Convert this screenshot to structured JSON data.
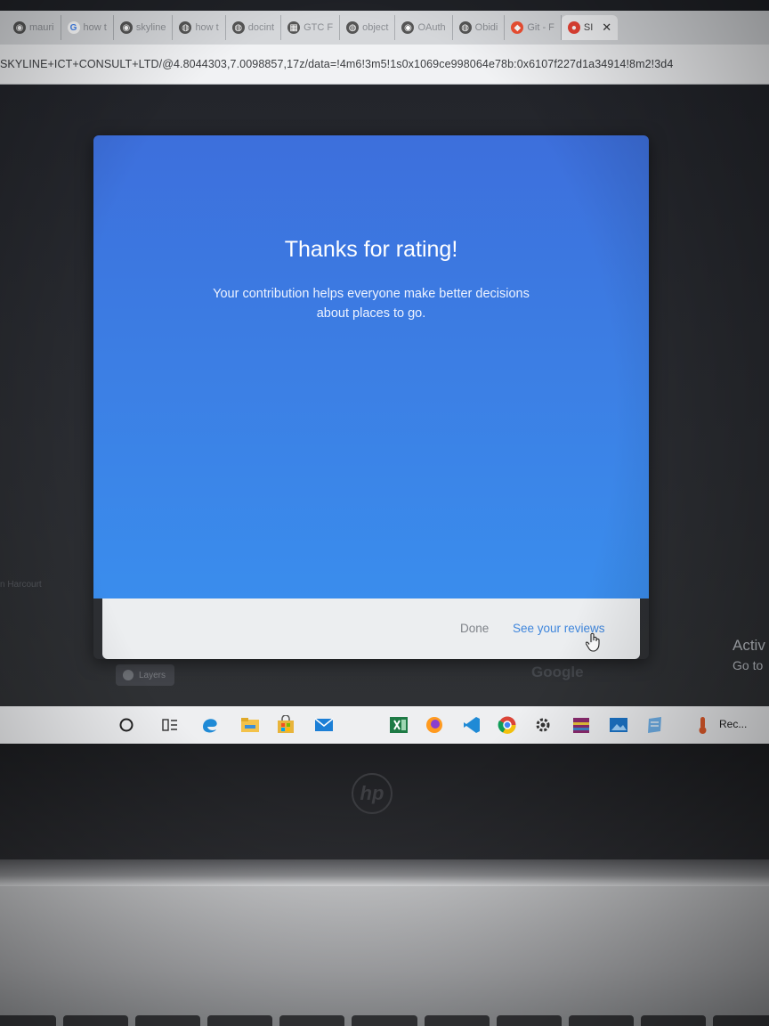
{
  "browser": {
    "tabs": [
      {
        "label": "mauri",
        "icon": "github-icon",
        "color": "#555555"
      },
      {
        "label": "how t",
        "icon": "google-icon",
        "color": "#4285f4"
      },
      {
        "label": "skyline",
        "icon": "github-icon",
        "color": "#555555"
      },
      {
        "label": "how t",
        "icon": "globe-icon",
        "color": "#555555"
      },
      {
        "label": "docint",
        "icon": "globe-icon",
        "color": "#555555"
      },
      {
        "label": "GTC F",
        "icon": "gtc-icon",
        "color": "#555555"
      },
      {
        "label": "object",
        "icon": "globe-icon",
        "color": "#555555"
      },
      {
        "label": "OAuth",
        "icon": "github-icon",
        "color": "#555555"
      },
      {
        "label": "Obidi",
        "icon": "globe-icon",
        "color": "#555555"
      },
      {
        "label": "Git - F",
        "icon": "git-icon",
        "color": "#f05033"
      },
      {
        "label": "SI",
        "icon": "maps-pin-icon",
        "color": "#ea4335",
        "active": true
      }
    ],
    "close_glyph": "✕",
    "url": "SKYLINE+ICT+CONSULT+LTD/@4.8044303,7.0098857,17z/data=!4m6!3m5!1s0x1069ce998064e78b:0x6107f227d1a34914!8m2!3d4"
  },
  "dialog": {
    "title": "Thanks for rating!",
    "message_line1": "Your contribution helps everyone make better decisions",
    "message_line2": "about places to go.",
    "done_label": "Done",
    "reviews_label": "See your reviews"
  },
  "background_page": {
    "layers_label": "Layers",
    "google_watermark": "Google",
    "map_text_left": "n Harcourt"
  },
  "windows_activation": {
    "line1": "Activ",
    "line2": "Go to"
  },
  "taskbar": {
    "tray_text": "Rec..."
  },
  "laptop": {
    "logo_text": "hp"
  },
  "colors": {
    "dialog_blue": "#3c7de3",
    "link_blue": "#3f86dc"
  }
}
